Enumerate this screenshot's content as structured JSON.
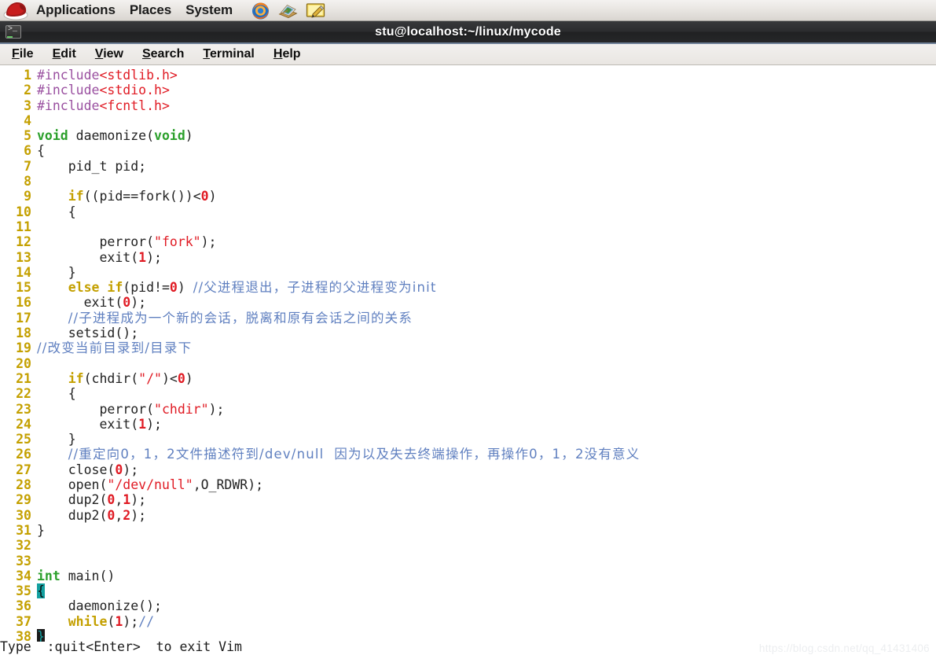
{
  "desktop_panel": {
    "logo_icon": "redhat-logo-icon",
    "menus": [
      {
        "label": "Applications"
      },
      {
        "label": "Places"
      },
      {
        "label": "System"
      }
    ],
    "launchers": [
      {
        "icon": "firefox-icon",
        "title": "Firefox Web Browser"
      },
      {
        "icon": "help-book-icon",
        "title": "Help / Documentation"
      },
      {
        "icon": "text-editor-icon",
        "title": "Text Editor"
      }
    ]
  },
  "terminal": {
    "window_icon": "terminal-icon",
    "title": "stu@localhost:~/linux/mycode",
    "menubar": [
      {
        "label": "File",
        "accesskey": "F"
      },
      {
        "label": "Edit",
        "accesskey": "E"
      },
      {
        "label": "View",
        "accesskey": "V"
      },
      {
        "label": "Search",
        "accesskey": "S"
      },
      {
        "label": "Terminal",
        "accesskey": "T"
      },
      {
        "label": "Help",
        "accesskey": "H"
      }
    ],
    "status_message": "Type  :quit<Enter>  to exit Vim"
  },
  "editor": {
    "lines": [
      {
        "n": "1",
        "tokens": [
          {
            "t": "#include",
            "c": "pre"
          },
          {
            "t": "<stdlib.h>",
            "c": "str"
          }
        ]
      },
      {
        "n": "2",
        "tokens": [
          {
            "t": "#include",
            "c": "pre"
          },
          {
            "t": "<stdio.h>",
            "c": "str"
          }
        ]
      },
      {
        "n": "3",
        "tokens": [
          {
            "t": "#include",
            "c": "pre"
          },
          {
            "t": "<fcntl.h>",
            "c": "str"
          }
        ]
      },
      {
        "n": "4",
        "tokens": []
      },
      {
        "n": "5",
        "tokens": [
          {
            "t": "void",
            "c": "type"
          },
          {
            "t": " daemonize(",
            "c": "txt"
          },
          {
            "t": "void",
            "c": "type"
          },
          {
            "t": ")",
            "c": "txt"
          }
        ]
      },
      {
        "n": "6",
        "tokens": [
          {
            "t": "{",
            "c": "txt"
          }
        ]
      },
      {
        "n": "7",
        "tokens": [
          {
            "t": "    pid_t pid;",
            "c": "txt"
          }
        ]
      },
      {
        "n": "8",
        "tokens": []
      },
      {
        "n": "9",
        "tokens": [
          {
            "t": "    ",
            "c": "txt"
          },
          {
            "t": "if",
            "c": "kw"
          },
          {
            "t": "((pid==fork())<",
            "c": "txt"
          },
          {
            "t": "0",
            "c": "num"
          },
          {
            "t": ")",
            "c": "txt"
          }
        ]
      },
      {
        "n": "10",
        "tokens": [
          {
            "t": "    {",
            "c": "txt"
          }
        ]
      },
      {
        "n": "11",
        "tokens": []
      },
      {
        "n": "12",
        "tokens": [
          {
            "t": "        perror(",
            "c": "txt"
          },
          {
            "t": "\"fork\"",
            "c": "str"
          },
          {
            "t": ");",
            "c": "txt"
          }
        ]
      },
      {
        "n": "13",
        "tokens": [
          {
            "t": "        exit(",
            "c": "txt"
          },
          {
            "t": "1",
            "c": "num"
          },
          {
            "t": ");",
            "c": "txt"
          }
        ]
      },
      {
        "n": "14",
        "tokens": [
          {
            "t": "    }",
            "c": "txt"
          }
        ]
      },
      {
        "n": "15",
        "tokens": [
          {
            "t": "    ",
            "c": "txt"
          },
          {
            "t": "else if",
            "c": "kw"
          },
          {
            "t": "(pid!=",
            "c": "txt"
          },
          {
            "t": "0",
            "c": "num"
          },
          {
            "t": ") ",
            "c": "txt"
          },
          {
            "t": "//父进程退出，子进程的父进程变为init",
            "c": "cmt",
            "cn": true
          }
        ]
      },
      {
        "n": "16",
        "tokens": [
          {
            "t": "      exit(",
            "c": "txt"
          },
          {
            "t": "0",
            "c": "num"
          },
          {
            "t": ");",
            "c": "txt"
          }
        ]
      },
      {
        "n": "17",
        "tokens": [
          {
            "t": "    ",
            "c": "txt"
          },
          {
            "t": "//子进程成为一个新的会话，脱离和原有会话之间的关系",
            "c": "cmt",
            "cn": true
          }
        ]
      },
      {
        "n": "18",
        "tokens": [
          {
            "t": "    setsid();",
            "c": "txt"
          }
        ]
      },
      {
        "n": "19",
        "tokens": [
          {
            "t": "//改变当前目录到/目录下",
            "c": "cmt",
            "cn": true
          }
        ]
      },
      {
        "n": "20",
        "tokens": []
      },
      {
        "n": "21",
        "tokens": [
          {
            "t": "    ",
            "c": "txt"
          },
          {
            "t": "if",
            "c": "kw"
          },
          {
            "t": "(chdir(",
            "c": "txt"
          },
          {
            "t": "\"/\"",
            "c": "str"
          },
          {
            "t": ")<",
            "c": "txt"
          },
          {
            "t": "0",
            "c": "num"
          },
          {
            "t": ")",
            "c": "txt"
          }
        ]
      },
      {
        "n": "22",
        "tokens": [
          {
            "t": "    {",
            "c": "txt"
          }
        ]
      },
      {
        "n": "23",
        "tokens": [
          {
            "t": "        perror(",
            "c": "txt"
          },
          {
            "t": "\"chdir\"",
            "c": "str"
          },
          {
            "t": ");",
            "c": "txt"
          }
        ]
      },
      {
        "n": "24",
        "tokens": [
          {
            "t": "        exit(",
            "c": "txt"
          },
          {
            "t": "1",
            "c": "num"
          },
          {
            "t": ");",
            "c": "txt"
          }
        ]
      },
      {
        "n": "25",
        "tokens": [
          {
            "t": "    }",
            "c": "txt"
          }
        ]
      },
      {
        "n": "26",
        "tokens": [
          {
            "t": "    ",
            "c": "txt"
          },
          {
            "t": "//重定向0，1，2文件描述符到/dev/null  因为以及失去终端操作，再操作0，1，2没有意义",
            "c": "cmt",
            "cn": true
          }
        ]
      },
      {
        "n": "27",
        "tokens": [
          {
            "t": "    close(",
            "c": "txt"
          },
          {
            "t": "0",
            "c": "num"
          },
          {
            "t": ");",
            "c": "txt"
          }
        ]
      },
      {
        "n": "28",
        "tokens": [
          {
            "t": "    open(",
            "c": "txt"
          },
          {
            "t": "\"/dev/null\"",
            "c": "str"
          },
          {
            "t": ",O_RDWR);",
            "c": "txt"
          }
        ]
      },
      {
        "n": "29",
        "tokens": [
          {
            "t": "    dup2(",
            "c": "txt"
          },
          {
            "t": "0",
            "c": "num"
          },
          {
            "t": ",",
            "c": "txt"
          },
          {
            "t": "1",
            "c": "num"
          },
          {
            "t": ");",
            "c": "txt"
          }
        ]
      },
      {
        "n": "30",
        "tokens": [
          {
            "t": "    dup2(",
            "c": "txt"
          },
          {
            "t": "0",
            "c": "num"
          },
          {
            "t": ",",
            "c": "txt"
          },
          {
            "t": "2",
            "c": "num"
          },
          {
            "t": ");",
            "c": "txt"
          }
        ]
      },
      {
        "n": "31",
        "tokens": [
          {
            "t": "}",
            "c": "txt"
          }
        ]
      },
      {
        "n": "32",
        "tokens": []
      },
      {
        "n": "33",
        "tokens": []
      },
      {
        "n": "34",
        "tokens": [
          {
            "t": "int",
            "c": "type"
          },
          {
            "t": " main()",
            "c": "txt"
          }
        ]
      },
      {
        "n": "35",
        "tokens": [
          {
            "t": "{",
            "c": "match"
          }
        ]
      },
      {
        "n": "36",
        "tokens": [
          {
            "t": "    daemonize();",
            "c": "txt"
          }
        ]
      },
      {
        "n": "37",
        "tokens": [
          {
            "t": "    ",
            "c": "txt"
          },
          {
            "t": "while",
            "c": "kw"
          },
          {
            "t": "(",
            "c": "txt"
          },
          {
            "t": "1",
            "c": "num"
          },
          {
            "t": ");",
            "c": "txt"
          },
          {
            "t": "//",
            "c": "cmt"
          }
        ]
      },
      {
        "n": "38",
        "tokens": [
          {
            "t": "}",
            "c": "cur"
          }
        ]
      }
    ]
  },
  "watermark": {
    "text": "https://blog.csdn.net/qq_41431406"
  },
  "colors": {
    "preprocessor": "#9a50a0",
    "string": "#e01b24",
    "type": "#2ca02c",
    "keyword": "#c4a000",
    "number": "#e01b24",
    "comment": "#6080c0",
    "line_number": "#c4a000",
    "match_brace_bg": "#13a0a0",
    "cursor_bg": "#1a1a1a",
    "titlebar_accent": "#6d7f96"
  }
}
